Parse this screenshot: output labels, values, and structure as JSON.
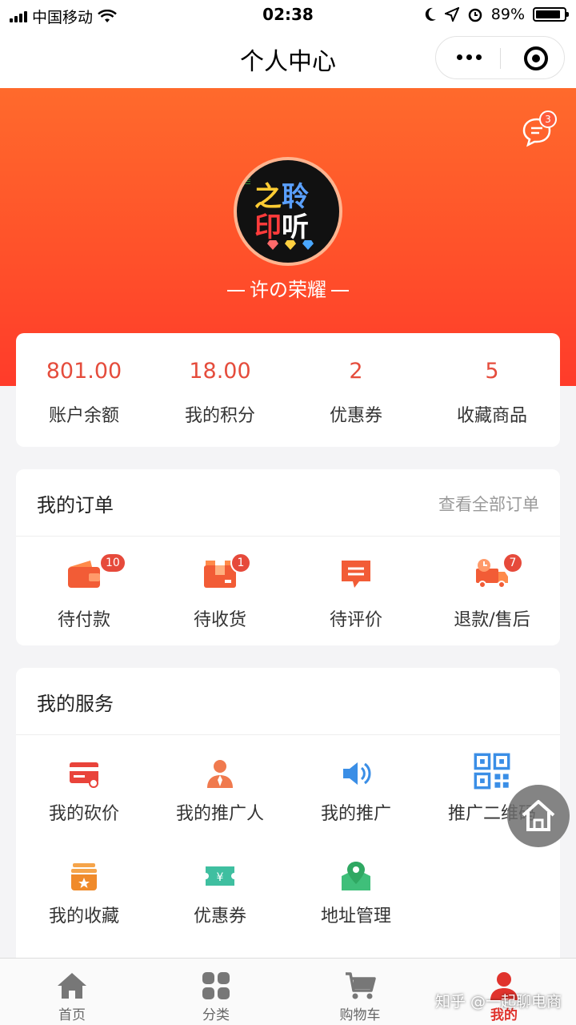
{
  "status_bar": {
    "carrier": "中国移动",
    "time": "02:38",
    "battery": "89%",
    "battery_level": 0.89
  },
  "nav": {
    "title": "个人中心"
  },
  "header": {
    "message_count": "3",
    "avatar_text_line1": "之聆",
    "avatar_text_line2": "印听",
    "username": "许の荣耀"
  },
  "stats": [
    {
      "value": "801.00",
      "label": "账户余额"
    },
    {
      "value": "18.00",
      "label": "我的积分"
    },
    {
      "value": "2",
      "label": "优惠券"
    },
    {
      "value": "5",
      "label": "收藏商品"
    }
  ],
  "orders": {
    "title": "我的订单",
    "link": "查看全部订单",
    "items": [
      {
        "label": "待付款",
        "badge": "10",
        "icon": "wallet-icon"
      },
      {
        "label": "待收货",
        "badge": "1",
        "icon": "package-icon"
      },
      {
        "label": "待评价",
        "badge": "",
        "icon": "comment-icon"
      },
      {
        "label": "退款/售后",
        "badge": "7",
        "icon": "delivery-truck-icon"
      }
    ]
  },
  "services": {
    "title": "我的服务",
    "items": [
      {
        "label": "我的砍价",
        "icon": "card-icon"
      },
      {
        "label": "我的推广人",
        "icon": "person-icon"
      },
      {
        "label": "我的推广",
        "icon": "speaker-icon"
      },
      {
        "label": "推广二维码",
        "icon": "qr-code-icon"
      },
      {
        "label": "我的收藏",
        "icon": "favorite-box-icon"
      },
      {
        "label": "优惠券",
        "icon": "coupon-icon"
      },
      {
        "label": "地址管理",
        "icon": "map-pin-icon"
      }
    ]
  },
  "tabs": [
    {
      "label": "首页",
      "icon": "home-icon",
      "active": false
    },
    {
      "label": "分类",
      "icon": "grid-icon",
      "active": false
    },
    {
      "label": "购物车",
      "icon": "cart-icon",
      "active": false
    },
    {
      "label": "我的",
      "icon": "user-icon",
      "active": true
    }
  ],
  "watermark": "知乎 @一起聊电商",
  "colors": {
    "accent": "#ff4f2a",
    "price_red": "#e54c3c",
    "active_tab": "#e0332d"
  }
}
